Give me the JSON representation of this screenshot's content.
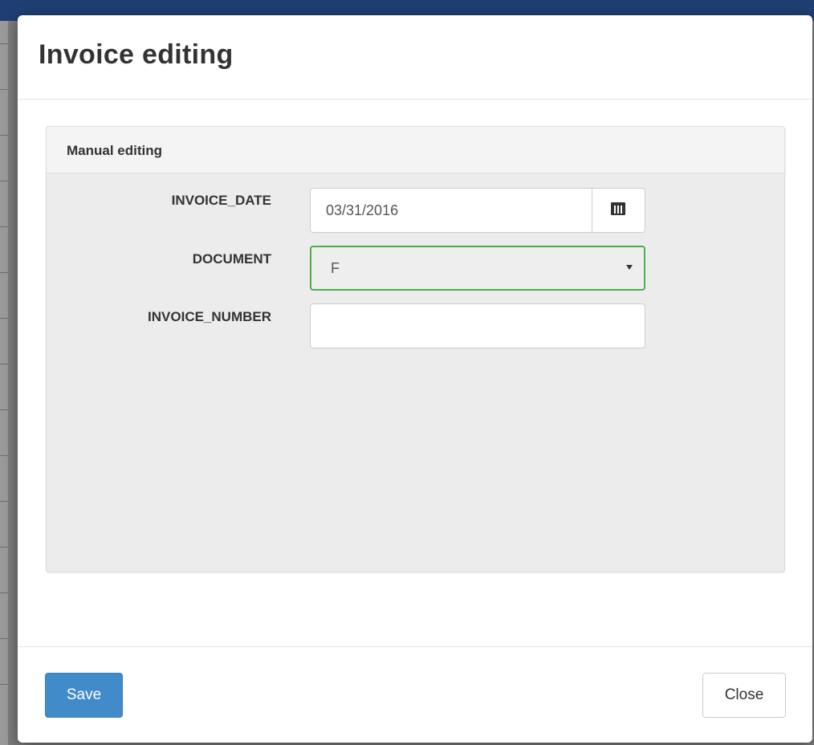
{
  "colors": {
    "topbar": "#1f3f73",
    "primary_button": "#428bca",
    "select_border_success": "#4cae4c"
  },
  "modal": {
    "title": "Invoice editing",
    "panel": {
      "title": "Manual editing",
      "fields": {
        "invoice_date": {
          "label": "INVOICE_DATE",
          "value": "03/31/2016",
          "icon": "calendar-icon"
        },
        "document": {
          "label": "DOCUMENT",
          "selected": "F",
          "icon": "caret-down-icon"
        },
        "invoice_number": {
          "label": "INVOICE_NUMBER",
          "value": ""
        }
      }
    },
    "footer": {
      "save_label": "Save",
      "close_label": "Close"
    }
  }
}
